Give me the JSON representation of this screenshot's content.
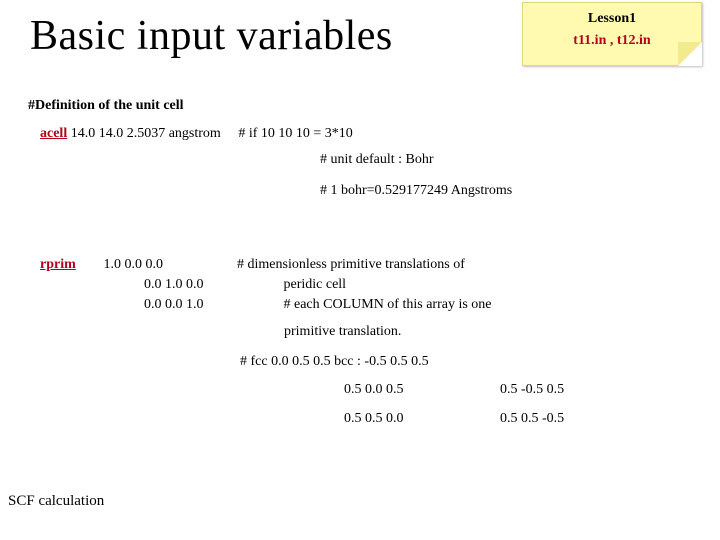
{
  "title": "Basic input variables",
  "note": {
    "line1": "Lesson1",
    "line2": "t11.in , t12.in"
  },
  "section_heading": "#Definition of the unit cell",
  "acell": {
    "keyword": "acell",
    "values": "14.0 14.0 2.5037 angstrom",
    "comments": [
      "# if 10 10 10 = 3*10",
      "# unit  default : Bohr",
      "# 1 bohr=0.529177249 Angstroms"
    ]
  },
  "rprim": {
    "keyword": "rprim",
    "rows": [
      {
        "vals": "1.0  0.0  0.0",
        "cmt": "# dimensionless primitive translations of"
      },
      {
        "vals": "0.0 1.0 0.0",
        "cmt": "peridic cell"
      },
      {
        "vals": "0.0  0.0  1.0",
        "cmt": "# each COLUMN of this array is one"
      }
    ],
    "tail": [
      "primitive translation."
    ],
    "examples_label": "# fcc 0.0 0.5 0.5   bcc  :  -0.5 0.5 0.5",
    "fcc_rows": [
      {
        "a": "0.5 0.0 0.5",
        "b": "0.5 -0.5 0.5"
      },
      {
        "a": "0.5 0.5 0.0",
        "b": "0.5 0.5 -0.5"
      }
    ]
  },
  "footer": "SCF calculation"
}
